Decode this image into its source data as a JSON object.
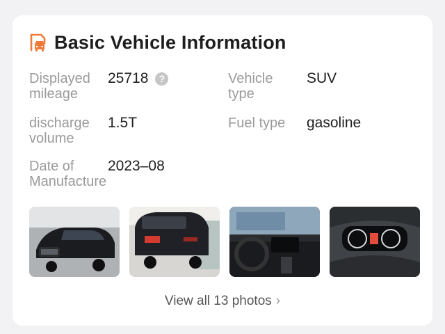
{
  "header": {
    "title": "Basic Vehicle Information",
    "icon": "car-document-icon"
  },
  "info": {
    "mileage": {
      "label_line1": "Displayed",
      "label_line2": "mileage",
      "value": "25718"
    },
    "vehicle_type": {
      "label_line1": "Vehicle",
      "label_line2": "type",
      "value": "SUV"
    },
    "displacement": {
      "label_line1": "discharge",
      "label_line2": "volume",
      "value": "1.5T"
    },
    "fuel_type": {
      "label": "Fuel type",
      "value": "gasoline"
    },
    "manufacture_date": {
      "label_line1": "Date of",
      "label_line2": "Manufacture",
      "value": "2023–08"
    }
  },
  "help_glyph": "?",
  "photos": [
    {
      "name": "front-view-photo"
    },
    {
      "name": "rear-view-photo"
    },
    {
      "name": "interior-dashboard-photo"
    },
    {
      "name": "instrument-cluster-photo"
    }
  ],
  "view_all": {
    "label": "View all 13 photos",
    "chevron": "›"
  },
  "colors": {
    "accent": "#f07a3a",
    "label": "#9a9a9a",
    "text": "#1e1e1e"
  }
}
